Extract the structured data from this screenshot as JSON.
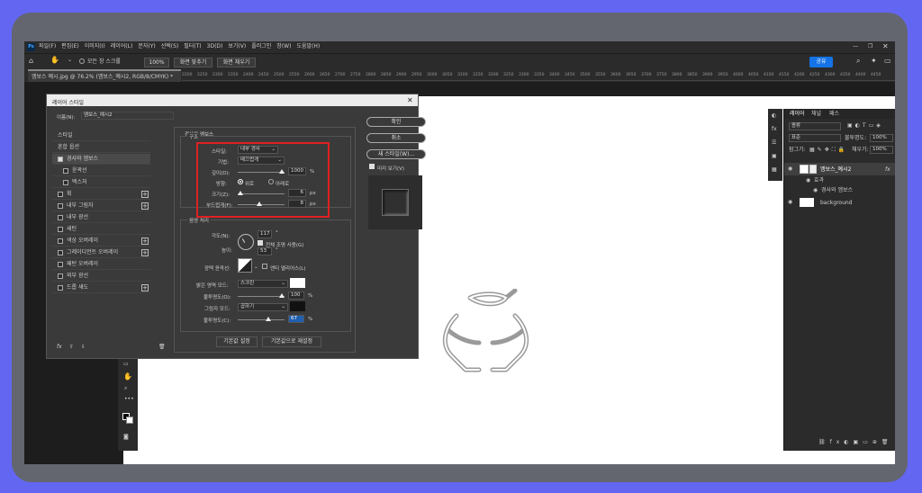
{
  "app": {
    "logo": "Ps",
    "menu": [
      "파일(F)",
      "편집(E)",
      "이미지(I)",
      "레이어(L)",
      "문자(Y)",
      "선택(S)",
      "필터(T)",
      "3D(D)",
      "보기(V)",
      "플러그인",
      "창(W)",
      "도움말(H)"
    ],
    "options": {
      "all_windows": "모든 창 스크롤",
      "zoom": "100%",
      "fit_screen": "화면 맞추기",
      "fill_screen": "화면 채우기",
      "share": "공유"
    },
    "doc_tab": "엠보스 예시.jpg @ 76.2% (엠보스_예시2, RGB/8/CMYK) *",
    "ruler_ticks": [
      "2200",
      "2250",
      "2300",
      "2350",
      "2400",
      "2450",
      "2500",
      "2550",
      "2600",
      "2650",
      "2700",
      "2750",
      "2800",
      "2850",
      "2900",
      "2950",
      "3000",
      "3050",
      "3100",
      "3150",
      "3200",
      "3250",
      "3300",
      "3350",
      "3400",
      "3450",
      "3500",
      "3550",
      "3600",
      "3650",
      "3700",
      "3750",
      "3800",
      "3850",
      "3900",
      "3950",
      "4000",
      "4050",
      "4100",
      "4150",
      "4200",
      "4250",
      "4300",
      "4350",
      "4400",
      "4450"
    ]
  },
  "dialog": {
    "title": "레이어 스타일",
    "name_label": "이름(N):",
    "name_value": "엠보스_예시2",
    "sidebar": [
      {
        "label": "스타일",
        "cb": false,
        "plus": false,
        "indent": 0,
        "check": null
      },
      {
        "label": "혼합 옵션",
        "cb": false,
        "plus": false,
        "indent": 0,
        "check": null
      },
      {
        "label": "경사와 엠보스",
        "cb": true,
        "plus": false,
        "indent": 0,
        "check": true,
        "active": true
      },
      {
        "label": "윤곽선",
        "cb": true,
        "plus": false,
        "indent": 1,
        "check": false
      },
      {
        "label": "텍스처",
        "cb": true,
        "plus": false,
        "indent": 1,
        "check": false
      },
      {
        "label": "획",
        "cb": true,
        "plus": true,
        "indent": 0,
        "check": false
      },
      {
        "label": "내부 그림자",
        "cb": true,
        "plus": true,
        "indent": 0,
        "check": false
      },
      {
        "label": "내부 광선",
        "cb": true,
        "plus": false,
        "indent": 0,
        "check": false
      },
      {
        "label": "새틴",
        "cb": true,
        "plus": false,
        "indent": 0,
        "check": false
      },
      {
        "label": "색상 오버레이",
        "cb": true,
        "plus": true,
        "indent": 0,
        "check": false
      },
      {
        "label": "그레이디언트 오버레이",
        "cb": true,
        "plus": true,
        "indent": 0,
        "check": false
      },
      {
        "label": "패턴 오버레이",
        "cb": true,
        "plus": false,
        "indent": 0,
        "check": false
      },
      {
        "label": "외부 광선",
        "cb": true,
        "plus": false,
        "indent": 0,
        "check": false
      },
      {
        "label": "드롭 섀도",
        "cb": true,
        "plus": true,
        "indent": 0,
        "check": false
      }
    ],
    "section_title": "경사와 엠보스",
    "structure_title": "구조",
    "style_label": "스타일:",
    "style_value": "내부 경사",
    "technique_label": "기법:",
    "technique_value": "매끄럽게",
    "depth_label": "깊이(D):",
    "depth_value": "1000",
    "direction_label": "방향:",
    "direction_up": "위로",
    "direction_down": "아래로",
    "size_label": "크기(Z):",
    "size_value": "6",
    "soften_label": "부드럽게(F):",
    "soften_value": "8",
    "shading_title": "음영 처리",
    "angle_label": "각도(N):",
    "angle_value": "117",
    "global_light": "전체 조명 사용(G)",
    "altitude_label": "높이:",
    "altitude_value": "53",
    "gloss_label": "광택 윤곽선:",
    "antialias": "앤티 앨리어스(L)",
    "highlight_label": "밝은 영역 모드:",
    "highlight_mode": "스크린",
    "highlight_opacity_label": "불투명도(O):",
    "highlight_opacity": "100",
    "shadow_label": "그림자 모드:",
    "shadow_mode": "곱하기",
    "shadow_opacity_label": "불투명도(C):",
    "shadow_opacity": "67",
    "unit_pct": "%",
    "unit_px": "px",
    "default_btn": "기본값 설정",
    "reset_btn": "기본값으로 재설정",
    "ok": "확인",
    "cancel": "취소",
    "new_style": "새 스타일(W)...",
    "preview": "미리 보기(V)",
    "fx": "fx"
  },
  "layers_panel": {
    "tabs": [
      "레이어",
      "채널",
      "패스"
    ],
    "kind_label": "종류",
    "blend_mode": "표준",
    "opacity_label": "불투명도:",
    "opacity_value": "100%",
    "lock_label": "잠그기:",
    "fill_label": "채우기:",
    "fill_value": "100%",
    "layers": [
      {
        "name": "엠보스_예시2",
        "fx": "fx"
      },
      {
        "name": "효과"
      },
      {
        "name": "경사와 엠보스"
      },
      {
        "name": "background"
      }
    ]
  }
}
